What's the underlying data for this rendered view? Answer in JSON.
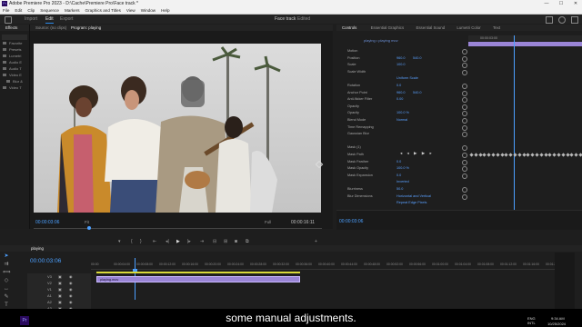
{
  "titlebar": {
    "title": "Adobe Premiere Pro 2023 - D:\\Cache\\Premiere Pro\\Face track *",
    "minimize": "—",
    "maximize": "☐",
    "close": "✕"
  },
  "menu": [
    "File",
    "Edit",
    "Clip",
    "Sequence",
    "Markers",
    "Graphics and Titles",
    "View",
    "Window",
    "Help"
  ],
  "workspace": {
    "tabs": [
      "Import",
      "Edit",
      "Export"
    ],
    "active": "Edit",
    "center": [
      "Face track",
      "Edited"
    ]
  },
  "left_panel": {
    "header": "Effects",
    "items": [
      "Favorite",
      "Presets",
      "Lumetri",
      "Audio E",
      "Audio T",
      "Video E",
      "Blur &",
      "Video T"
    ]
  },
  "source_panel": {
    "tab": "Source: (no clips)"
  },
  "program": {
    "tab": "Program: playing",
    "timecode": "00:00:03:06",
    "fit": "Fit",
    "quality": "Full",
    "duration": "00:00:16:11"
  },
  "effect_controls": {
    "tabs": [
      "Controls",
      "Essential Graphics",
      "Essential Sound",
      "Lumetri Color",
      "Text"
    ],
    "clip_path": "playing • playing mov",
    "ruler_time": "00:00:03:00",
    "rows": [
      {
        "label": "Motion",
        "value": "",
        "value2": ""
      },
      {
        "label": "Position",
        "value": "960.0",
        "value2": "540.0"
      },
      {
        "label": "Scale",
        "value": "100.0",
        "value2": ""
      },
      {
        "label": "Scale Width",
        "value": "",
        "value2": ""
      },
      {
        "label": "",
        "value": "Uniform Scale",
        "value2": ""
      },
      {
        "label": "Rotation",
        "value": "0.0",
        "value2": ""
      },
      {
        "label": "Anchor Point",
        "value": "960.0",
        "value2": "540.0"
      },
      {
        "label": "Anti-flicker Filter",
        "value": "0.00",
        "value2": ""
      },
      {
        "label": "Opacity",
        "value": "",
        "value2": ""
      },
      {
        "label": "Opacity",
        "value": "100.0 %",
        "value2": ""
      },
      {
        "label": "Blend Mode",
        "value": "Normal",
        "value2": ""
      },
      {
        "label": "Time Remapping",
        "value": "",
        "value2": ""
      },
      {
        "label": "Gaussian Blur",
        "value": "",
        "value2": ""
      },
      {
        "label": "",
        "value": "",
        "value2": ""
      },
      {
        "label": "Mask (1)",
        "value": "",
        "value2": ""
      },
      {
        "label": "Mask Path",
        "value": "",
        "value2": ""
      },
      {
        "label": "Mask Feather",
        "value": "0.0",
        "value2": ""
      },
      {
        "label": "Mask Opacity",
        "value": "100.0 %",
        "value2": ""
      },
      {
        "label": "Mask Expansion",
        "value": "0.0",
        "value2": ""
      },
      {
        "label": "",
        "value": "Inverted",
        "value2": ""
      },
      {
        "label": "Blurriness",
        "value": "50.0",
        "value2": ""
      },
      {
        "label": "Blur Dimensions",
        "value": "Horizontal and Vertical",
        "value2": ""
      },
      {
        "label": "",
        "value": "Repeat Edge Pixels",
        "value2": ""
      }
    ],
    "footer_time": "00:00:03:06"
  },
  "timeline": {
    "sequence": "playing",
    "timecode": "00:00:03:06",
    "ruler": [
      "00:00",
      "00:00:04:00",
      "00:00:08:00",
      "00:00:12:00",
      "00:00:16:00",
      "00:00:20:00",
      "00:00:24:00",
      "00:00:28:00",
      "00:00:32:00",
      "00:00:36:00",
      "00:00:40:00",
      "00:00:44:00",
      "00:00:48:00",
      "00:00:52:00",
      "00:00:56:00",
      "00:01:00:00",
      "00:01:04:00",
      "00:01:08:00",
      "00:01:12:00",
      "00:01:16:00",
      "00:01:20:00"
    ],
    "tracks": [
      "V3",
      "V2",
      "V1",
      "A1",
      "A2",
      "A3"
    ],
    "clip_name": "playing.mov"
  },
  "caption": "some manual adjustments.",
  "taskbar": {
    "lang": "ENG\nINTL",
    "time": "9:34 AM",
    "date": "10/25/2024"
  },
  "colors": {
    "accent": "#2d8ceb",
    "clip": "#9a85d6",
    "clip_label": "#c9b8ff",
    "value_blue": "#5aa0ff"
  }
}
